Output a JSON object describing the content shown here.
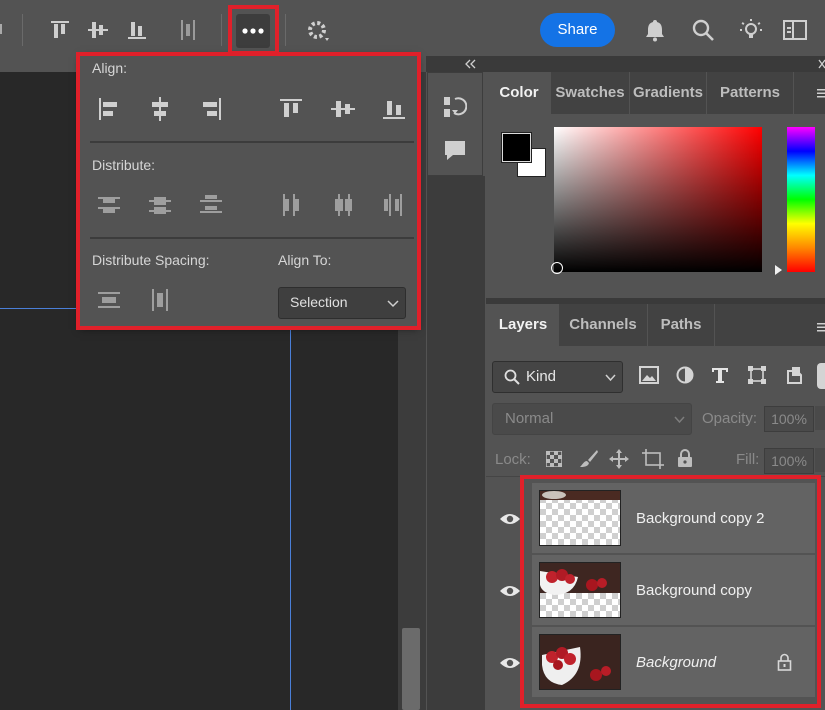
{
  "toolbar": {
    "share_label": "Share",
    "icons": [
      "align-top-edges-icon",
      "align-vertical-centers-icon",
      "align-bottom-edges-icon",
      "distribute-horizontal-icon",
      "more-options-icon",
      "settings-gear-icon",
      "notification-bell-icon",
      "search-icon",
      "tips-lightbulb-icon",
      "workspace-layout-icon"
    ]
  },
  "popover": {
    "align_label": "Align:",
    "distribute_label": "Distribute:",
    "distribute_spacing_label": "Distribute Spacing:",
    "align_to_label": "Align To:",
    "align_to_value": "Selection"
  },
  "color_panel": {
    "tabs": [
      "Color",
      "Swatches",
      "Gradients",
      "Patterns"
    ],
    "active_tab": "Color",
    "foreground_color": "#000000",
    "background_color": "#ffffff",
    "hue_color": "#ff0000"
  },
  "layers_panel": {
    "tabs": [
      "Layers",
      "Channels",
      "Paths"
    ],
    "active_tab": "Layers",
    "filter_label": "Kind",
    "blend_mode": "Normal",
    "opacity_label": "Opacity:",
    "opacity_value": "100%",
    "lock_label": "Lock:",
    "fill_label": "Fill:",
    "fill_value": "100%",
    "layers": [
      {
        "name": "Background copy 2",
        "visible": true,
        "locked": false
      },
      {
        "name": "Background copy",
        "visible": true,
        "locked": false
      },
      {
        "name": "Background",
        "visible": true,
        "locked": true
      }
    ]
  },
  "colors": {
    "accent": "#1473e6",
    "highlight": "#e0202a",
    "guide": "#4a7fd8"
  }
}
